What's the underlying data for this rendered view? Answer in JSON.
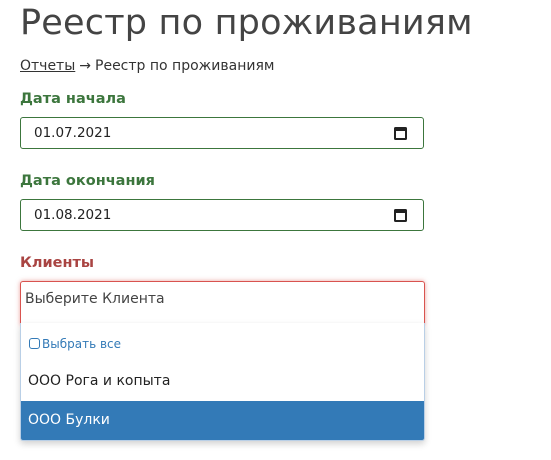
{
  "page": {
    "title": "Реестр по проживаниям"
  },
  "breadcrumb": {
    "link": "Отчеты",
    "separator": "→",
    "current": "Реестр по проживаниям"
  },
  "form": {
    "start_date": {
      "label": "Дата начала",
      "value": "01.07.2021",
      "icon": "calendar-icon"
    },
    "end_date": {
      "label": "Дата окончания",
      "value": "01.08.2021",
      "icon": "calendar-icon"
    },
    "clients": {
      "label": "Клиенты",
      "placeholder": "Выберите Клиента",
      "select_all": "Выбрать все",
      "options": [
        {
          "label": "ООО Рога и копыта",
          "highlighted": false
        },
        {
          "label": "ООО Булки",
          "highlighted": true
        }
      ]
    }
  },
  "colors": {
    "valid_label": "#3c763d",
    "error_label": "#a94442",
    "error_border": "#d9534f",
    "highlight": "#337ab7"
  }
}
